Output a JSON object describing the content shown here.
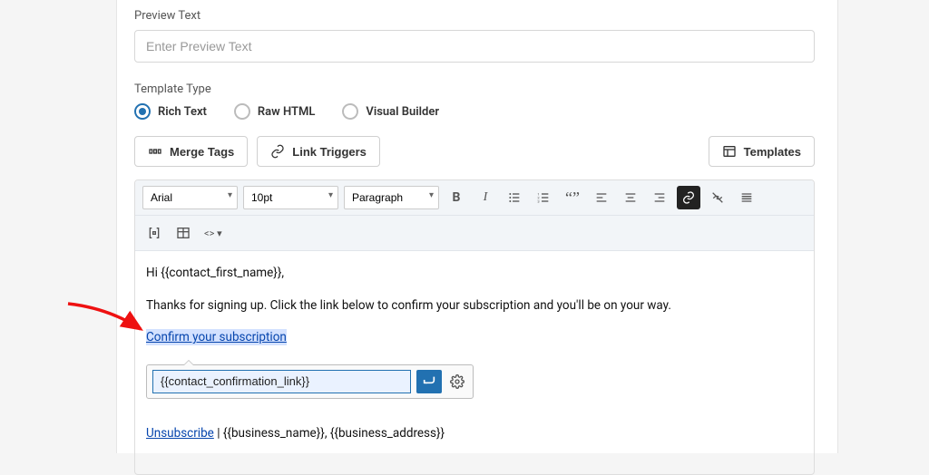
{
  "preview": {
    "label": "Preview Text",
    "placeholder": "Enter Preview Text"
  },
  "template_type": {
    "label": "Template Type",
    "options": [
      "Rich Text",
      "Raw HTML",
      "Visual Builder"
    ],
    "selected": "Rich Text"
  },
  "buttons": {
    "merge_tags": "Merge Tags",
    "link_triggers": "Link Triggers",
    "templates": "Templates"
  },
  "toolbar": {
    "font": "Arial",
    "size": "10pt",
    "block": "Paragraph"
  },
  "body": {
    "greeting": "Hi {{contact_first_name}},",
    "intro": "Thanks for signing up. Click the link below to confirm your subscription and you'll be on your way.",
    "confirm_link_text": "Confirm your subscription",
    "link_popup_value": "{{contact_confirmation_link}}",
    "unsubscribe": "Unsubscribe",
    "footer_sep": " | ",
    "footer_tail": "{{business_name}}, {{business_address}}"
  }
}
